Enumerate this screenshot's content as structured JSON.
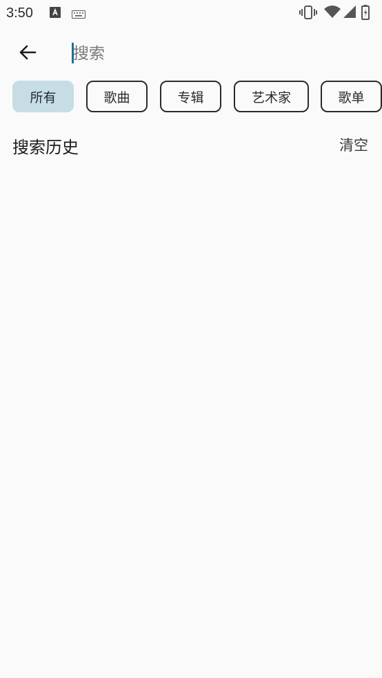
{
  "status_bar": {
    "time": "3:50",
    "icons": [
      "accessibility-a-icon",
      "keyboard-icon",
      "vibrate-icon",
      "wifi-icon",
      "cell-signal-icon",
      "battery-icon"
    ]
  },
  "search": {
    "placeholder": "搜索",
    "value": ""
  },
  "filters": {
    "items": [
      {
        "label": "所有",
        "selected": true
      },
      {
        "label": "歌曲",
        "selected": false
      },
      {
        "label": "专辑",
        "selected": false
      },
      {
        "label": "艺术家",
        "selected": false
      },
      {
        "label": "歌单",
        "selected": false
      }
    ]
  },
  "history": {
    "title": "搜索历史",
    "clear_label": "清空"
  },
  "colors": {
    "accent": "#1f6f8b",
    "chip_selected": "#c7dde6",
    "background": "#fafafa"
  }
}
